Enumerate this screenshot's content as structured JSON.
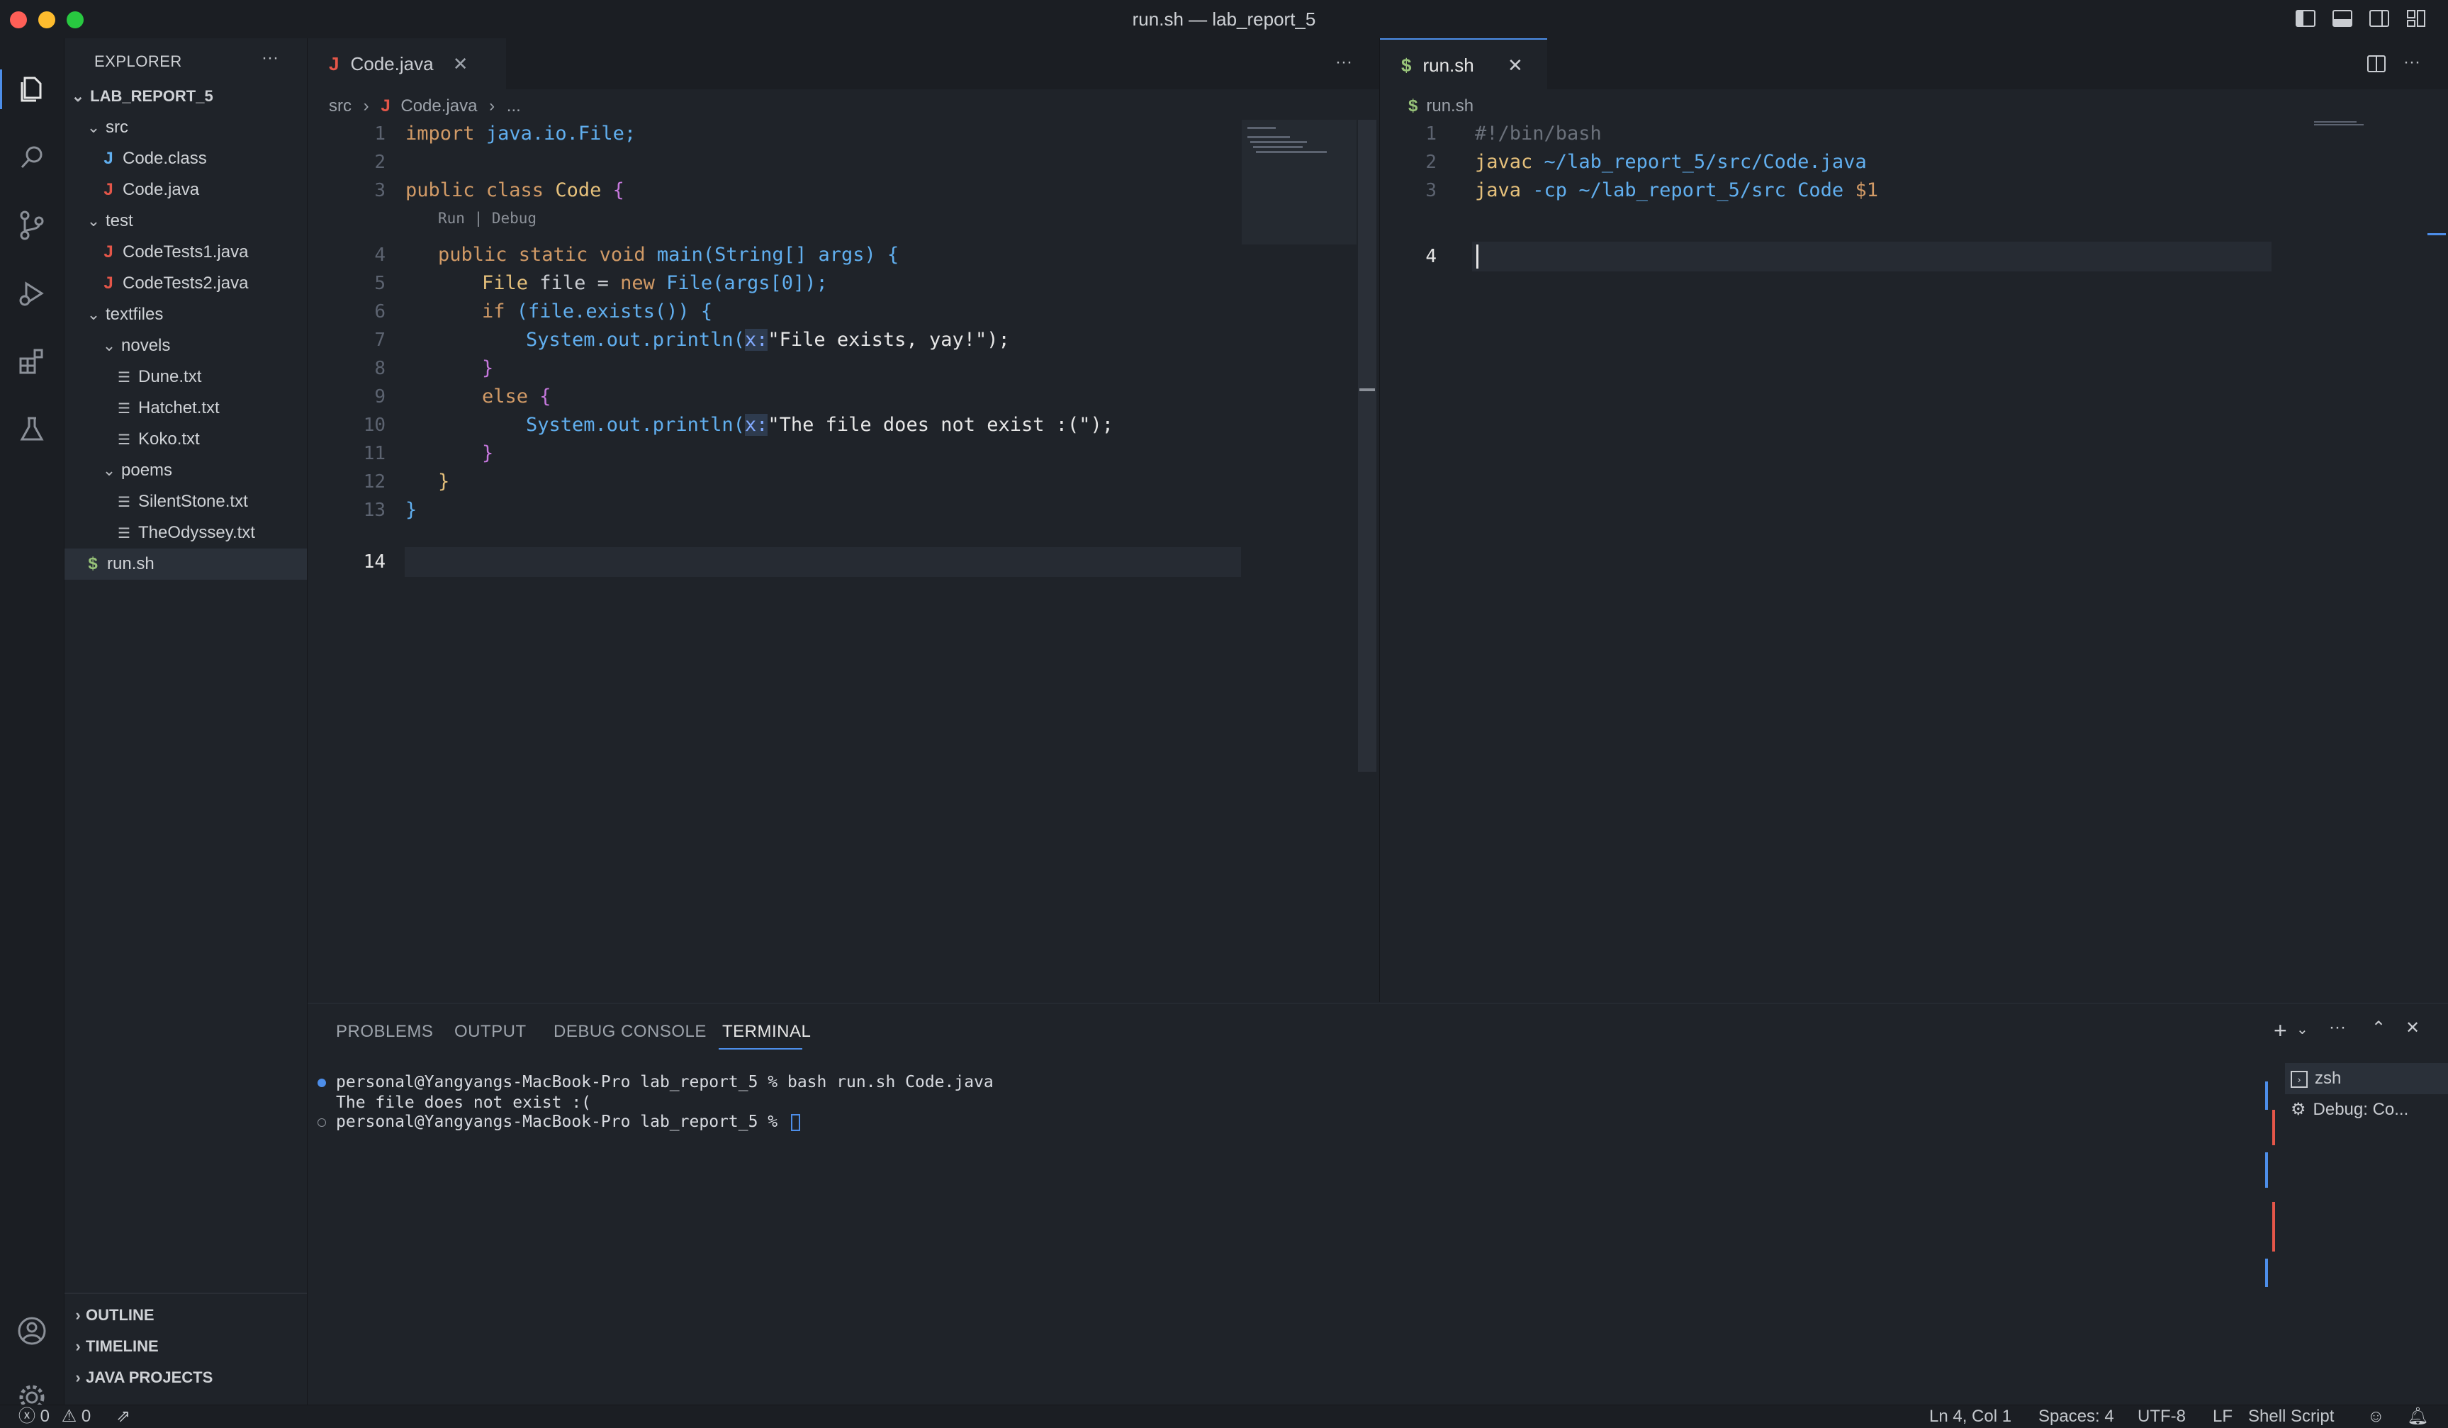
{
  "window": {
    "title": "run.sh — lab_report_5"
  },
  "colors": {
    "accent": "#4d8ee9",
    "java": "#e45649",
    "shell": "#98c379",
    "close": "#ff5f57",
    "minimize": "#febc2e",
    "maximize": "#28c840"
  },
  "explorer": {
    "header": "EXPLORER",
    "more": "···",
    "root": "LAB_REPORT_5",
    "tree": [
      {
        "label": "src",
        "type": "folder",
        "depth": 1
      },
      {
        "label": "Code.class",
        "type": "class",
        "depth": 2
      },
      {
        "label": "Code.java",
        "type": "java",
        "depth": 2
      },
      {
        "label": "test",
        "type": "folder",
        "depth": 1
      },
      {
        "label": "CodeTests1.java",
        "type": "java",
        "depth": 2
      },
      {
        "label": "CodeTests2.java",
        "type": "java",
        "depth": 2
      },
      {
        "label": "textfiles",
        "type": "folder",
        "depth": 1
      },
      {
        "label": "novels",
        "type": "folder",
        "depth": 2
      },
      {
        "label": "Dune.txt",
        "type": "text",
        "depth": 3
      },
      {
        "label": "Hatchet.txt",
        "type": "text",
        "depth": 3
      },
      {
        "label": "Koko.txt",
        "type": "text",
        "depth": 3
      },
      {
        "label": "poems",
        "type": "folder",
        "depth": 2
      },
      {
        "label": "SilentStone.txt",
        "type": "text",
        "depth": 3
      },
      {
        "label": "TheOdyssey.txt",
        "type": "text",
        "depth": 3
      },
      {
        "label": "run.sh",
        "type": "shell",
        "depth": 1
      }
    ],
    "sections": [
      "OUTLINE",
      "TIMELINE",
      "JAVA PROJECTS"
    ]
  },
  "left_editor": {
    "tab": "Code.java",
    "more": "···",
    "breadcrumb": {
      "folder": "src",
      "file": "Code.java",
      "tail": "..."
    },
    "codelens": "Run | Debug",
    "line_numbers": [
      "1",
      "2",
      "3",
      "4",
      "5",
      "6",
      "7",
      "8",
      "9",
      "10",
      "11",
      "12",
      "13",
      "14"
    ],
    "code": {
      "l1_kw": "import",
      "l1_rest": "java.io.File;",
      "l3_a": "public class",
      "l3_b": "Code",
      "l3_c": "{",
      "l4_a": "public static void",
      "l4_b": "main(String[] args) {",
      "l5_a": "File",
      "l5_b": "file =",
      "l5_c": "new",
      "l5_d": "File(args[0]);",
      "l6_a": "if",
      "l6_b": "(file.exists()) {",
      "l7_a": "System.out.println(",
      "l7_hint": "x:",
      "l7_b": "\"File exists, yay!\");",
      "l8": "}",
      "l9_a": "else",
      "l9_b": "{",
      "l10_a": "System.out.println(",
      "l10_hint": "x:",
      "l10_b": "\"The file does not exist :(\");",
      "l11": "}",
      "l12": "}",
      "l13": "}"
    }
  },
  "right_editor": {
    "tab": "run.sh",
    "more": "···",
    "breadcrumb": "run.sh",
    "line_numbers": [
      "1",
      "2",
      "3",
      "4"
    ],
    "lines": [
      {
        "a": "#!/bin/bash",
        "b": ""
      },
      {
        "a": "javac",
        "b": "~/lab_report_5/src/Code.java"
      },
      {
        "a": "java",
        "b": "-cp ~/lab_report_5/src Code",
        "c": "$1"
      }
    ]
  },
  "panel": {
    "tabs": [
      "PROBLEMS",
      "OUTPUT",
      "DEBUG CONSOLE",
      "TERMINAL"
    ],
    "active_tab": "TERMINAL",
    "terminal_lines": [
      "personal@Yangyangs-MacBook-Pro lab_report_5 % bash run.sh Code.java",
      "The file does not exist :(",
      "personal@Yangyangs-MacBook-Pro lab_report_5 % "
    ],
    "more": "···",
    "sessions": [
      "zsh",
      "Debug: Co..."
    ]
  },
  "statusbar": {
    "errors": "0",
    "warnings": "0",
    "position": "Ln 4, Col 1",
    "spaces": "Spaces: 4",
    "encoding": "UTF-8",
    "eol": "LF",
    "language": "Shell Script"
  }
}
